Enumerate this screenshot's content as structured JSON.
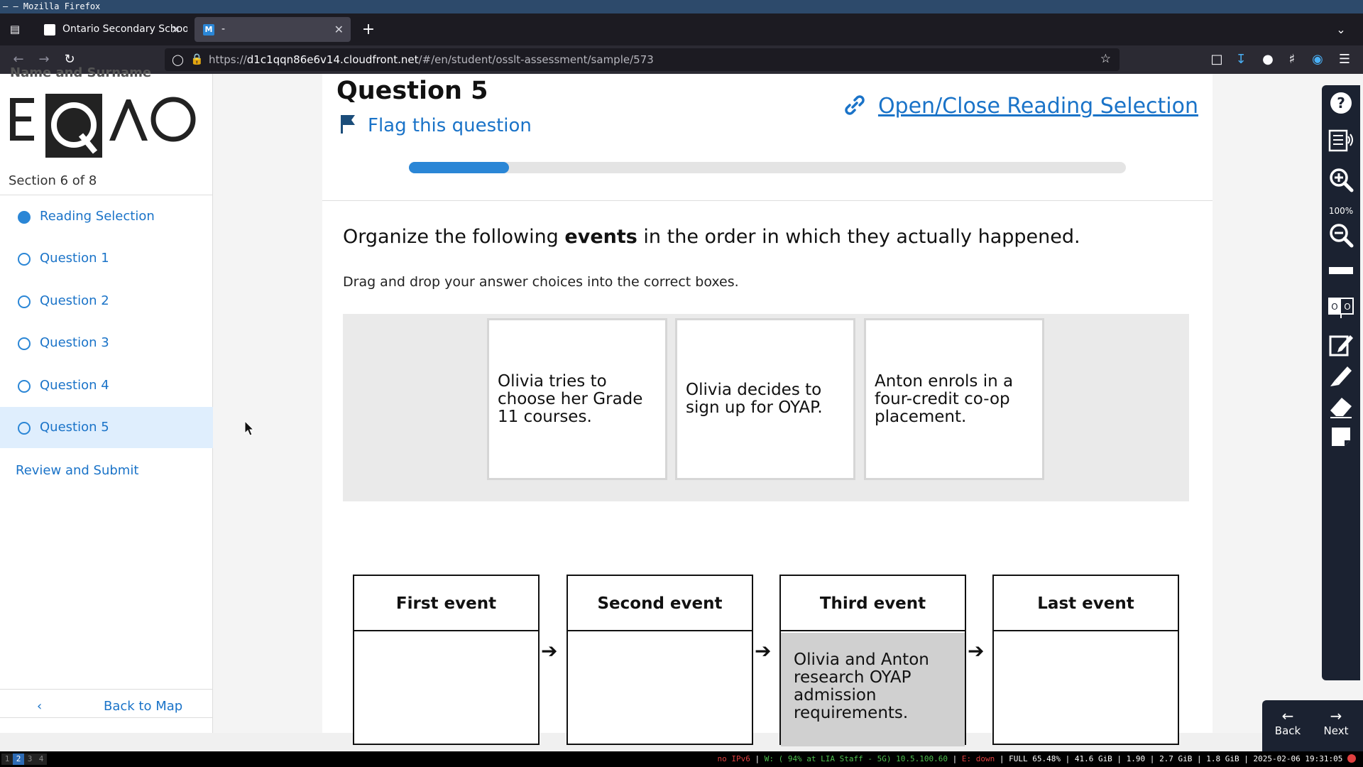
{
  "window": {
    "title": "– — Mozilla Firefox"
  },
  "tabs": [
    {
      "title": "Ontario Secondary School",
      "favicon_color": "#ffffff"
    },
    {
      "title": "-",
      "favicon_color": "#2a86d6",
      "favicon_letter": "M"
    }
  ],
  "url": {
    "prefix": "https://",
    "host": "d1c1qqn86e6v14.cloudfront.net",
    "path": "/#/en/student/osslt-assessment/sample/573"
  },
  "sidebar": {
    "clipped_header": "Name and Surname",
    "logo_text": "EQAO",
    "section": "Section 6 of 8",
    "items": [
      {
        "label": "Reading Selection"
      },
      {
        "label": "Question 1"
      },
      {
        "label": "Question 2"
      },
      {
        "label": "Question 3"
      },
      {
        "label": "Question 4"
      },
      {
        "label": "Question 5"
      }
    ],
    "review": "Review and Submit",
    "back_to_map": "Back to Map"
  },
  "question": {
    "title": "Question 5",
    "flag_label": "Flag this question",
    "open_close": "Open/Close Reading Selection",
    "progress_fraction": 0.14,
    "prompt_before": "Organize the following ",
    "prompt_bold": "events",
    "prompt_after": " in the order in which they actually happened.",
    "instructions": "Drag and drop your answer choices into the correct boxes.",
    "choices": [
      "Olivia tries to choose her Grade 11 courses.",
      "Olivia decides to sign up for OYAP.",
      "Anton enrols in a four-credit co-op placement."
    ],
    "targets": [
      {
        "header": "First event",
        "content": ""
      },
      {
        "header": "Second event",
        "content": ""
      },
      {
        "header": "Third event",
        "content": "Olivia and Anton research OYAP admission requirements."
      },
      {
        "header": "Last event",
        "content": ""
      }
    ]
  },
  "toolbar": {
    "zoom": "100%"
  },
  "nav": {
    "back": "Back",
    "next": "Next"
  },
  "statusbar": {
    "workspaces": [
      "1",
      "2",
      "3",
      "4"
    ],
    "ipv6": "no IPv6",
    "wifi": "W: ( 94% at LIA Staff - 5G) 10.5.100.60",
    "eth": "E: down",
    "battery": "FULL 65.48%",
    "disk": "41.6 GiB",
    "load": "1.90",
    "mem": "2.7 GiB | 1.8 GiB",
    "datetime": "2025-02-06 19:31:05"
  }
}
